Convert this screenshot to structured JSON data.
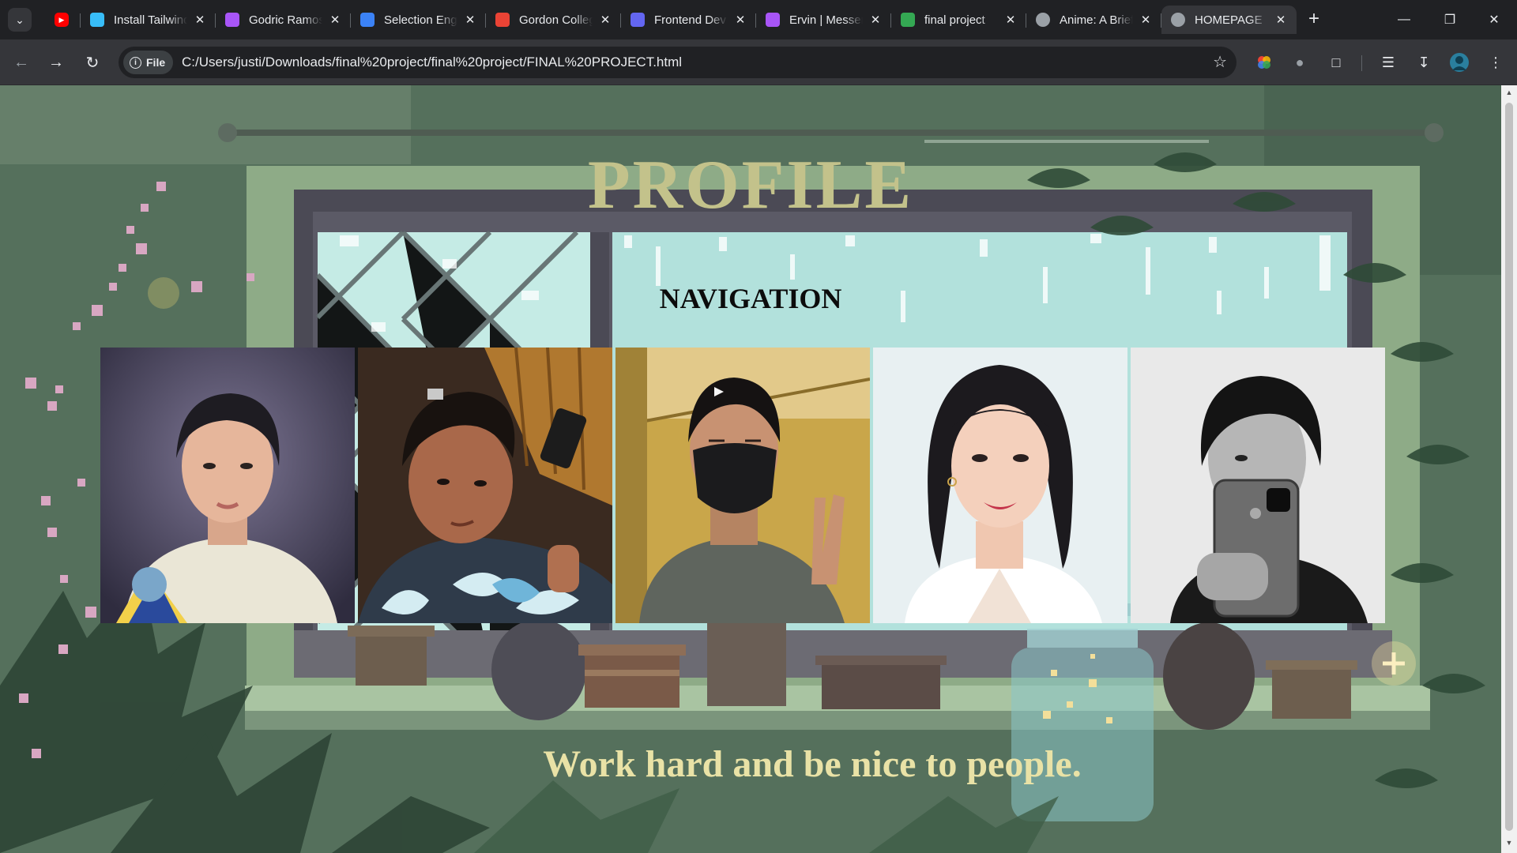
{
  "browser": {
    "tabs": [
      {
        "title": "",
        "favicon": "youtube-icon",
        "color": "#ff0000",
        "pinned": true
      },
      {
        "title": "Install Tailwind",
        "favicon": "tailwind-icon",
        "color": "#38bdf8"
      },
      {
        "title": "Godric Ramos",
        "favicon": "messenger-icon",
        "color": "#a855f7"
      },
      {
        "title": "Selection Engine",
        "favicon": "zoho-icon",
        "color": "#3b82f6"
      },
      {
        "title": "Gordon College",
        "favicon": "gmail-icon",
        "color": "#ea4335"
      },
      {
        "title": "Frontend Dev",
        "favicon": "list-icon",
        "color": "#6366f1"
      },
      {
        "title": "Ervin | Messenger",
        "favicon": "messenger-icon",
        "color": "#a855f7"
      },
      {
        "title": "final project",
        "favicon": "drive-icon",
        "color": "#34a853"
      },
      {
        "title": "Anime: A Brief",
        "favicon": "globe-icon",
        "color": "#9aa0a6"
      },
      {
        "title": "HOMEPAGE",
        "favicon": "globe-icon",
        "color": "#9aa0a6",
        "active": true
      }
    ],
    "new_tab_label": "+",
    "address": {
      "chip_label": "File",
      "url": "C:/Users/justi/Downloads/final%20project/final%20project/FINAL%20PROJECT.html"
    }
  },
  "page": {
    "title": "PROFILE",
    "nav_heading": "NAVIGATION",
    "photos": [
      {
        "name": "profile-photo-1",
        "desc": "graduation portrait"
      },
      {
        "name": "profile-photo-2",
        "desc": "selfie thumbs up"
      },
      {
        "name": "profile-photo-3",
        "desc": "masked peace sign"
      },
      {
        "name": "profile-photo-4",
        "desc": "portrait white blouse"
      },
      {
        "name": "profile-photo-5",
        "desc": "mirror selfie grayscale"
      }
    ],
    "quote": "Work hard and be nice to people."
  },
  "colors": {
    "title": "#c3c28b",
    "quote": "#e9e2a6",
    "window_sky": "#b7e3df",
    "wall": "#55705c"
  }
}
